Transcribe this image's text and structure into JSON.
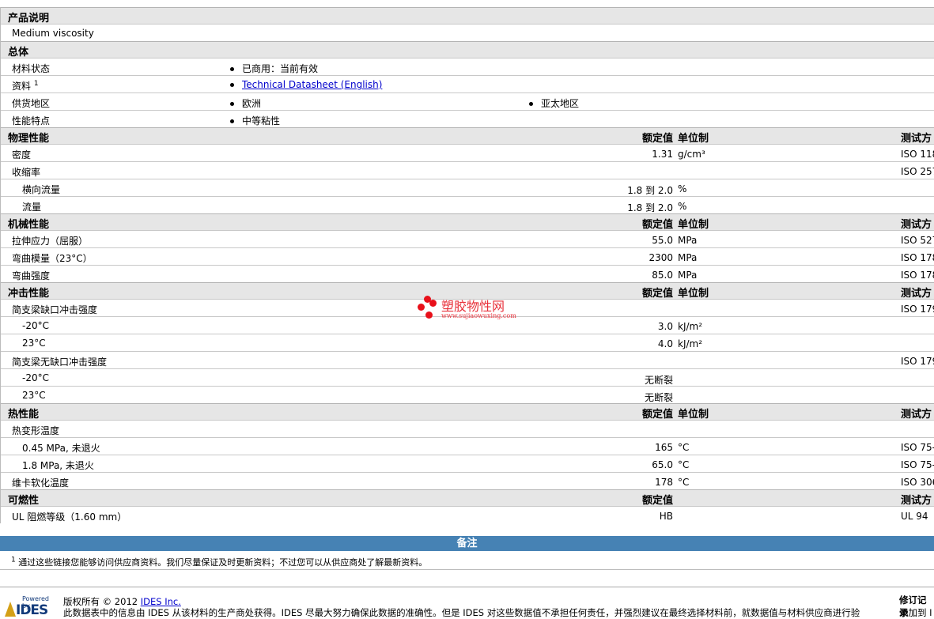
{
  "sections": [
    {
      "title": "产品说明",
      "rows": [
        {
          "label": "Medium viscosity"
        }
      ]
    },
    {
      "title": "总体",
      "rows": [
        {
          "label": "材料状态",
          "b1": "已商用：当前有效"
        },
        {
          "label": "资料",
          "sup": "1",
          "b1": "Technical Datasheet (English)",
          "link": true
        },
        {
          "label": "供货地区",
          "b1": "欧洲",
          "b2": "亚太地区"
        },
        {
          "label": "性能特点",
          "b1": "中等粘性"
        }
      ]
    },
    {
      "title": "物理性能",
      "value": "额定值",
      "unit": "单位制",
      "test": "测试方",
      "rows": [
        {
          "label": "密度",
          "value": "1.31",
          "unit": "g/cm³",
          "test": "ISO 118"
        },
        {
          "label": "收缩率",
          "test": "ISO 257"
        },
        {
          "label": "横向流量",
          "sub": true,
          "value": "1.8 到  2.0",
          "unit": "%"
        },
        {
          "label": "流量",
          "sub": true,
          "value": "1.8 到  2.0",
          "unit": "%"
        }
      ]
    },
    {
      "title": "机械性能",
      "value": "额定值",
      "unit": "单位制",
      "test": "测试方",
      "rows": [
        {
          "label": "拉伸应力（屈服）",
          "value": "55.0",
          "unit": "MPa",
          "test": "ISO 527"
        },
        {
          "label": "弯曲模量（23°C）",
          "value": "2300",
          "unit": "MPa",
          "test": "ISO 178"
        },
        {
          "label": "弯曲强度",
          "value": "85.0",
          "unit": "MPa",
          "test": "ISO 178"
        }
      ]
    },
    {
      "title": "冲击性能",
      "value": "额定值",
      "unit": "单位制",
      "test": "测试方",
      "rows": [
        {
          "label": "简支梁缺口冲击强度",
          "test": "ISO 179"
        },
        {
          "label": "-20°C",
          "sub": true,
          "value": "3.0",
          "unit": "kJ/m²"
        },
        {
          "label": "23°C",
          "sub": true,
          "value": "4.0",
          "unit": "kJ/m²"
        },
        {
          "label": "简支梁无缺口冲击强度",
          "test": "ISO 179"
        },
        {
          "label": "-20°C",
          "sub": true,
          "value": "无断裂"
        },
        {
          "label": "23°C",
          "sub": true,
          "value": "无断裂"
        }
      ]
    },
    {
      "title": "热性能",
      "value": "额定值",
      "unit": "单位制",
      "test": "测试方",
      "rows": [
        {
          "label": "热变形温度"
        },
        {
          "label": "0.45 MPa, 未退火",
          "sub": true,
          "value": "165",
          "unit": "°C",
          "test": "ISO 75-2"
        },
        {
          "label": "1.8 MPa, 未退火",
          "sub": true,
          "value": "65.0",
          "unit": "°C",
          "test": "ISO 75-2"
        },
        {
          "label": "维卡软化温度",
          "value": "178",
          "unit": "°C",
          "test": "ISO 306"
        }
      ]
    },
    {
      "title": "可燃性",
      "value": "额定值",
      "test": "测试方",
      "rows": [
        {
          "label": "UL 阻燃等级（1.60 mm）",
          "value": "HB",
          "test": "UL 94"
        }
      ]
    }
  ],
  "notes": {
    "title": "备注",
    "footnote_mark": "1",
    "footnote": "通过这些链接您能够访问供应商资料。我们尽量保证及时更新资料；不过您可以从供应商处了解最新资料。"
  },
  "footer": {
    "logo_powered": "Powered by",
    "logo_name": "IDES",
    "copyright": "版权所有 © 2012 ",
    "company_link": "IDES Inc.",
    "disclaimer": "此数据表中的信息由 IDES 从该材料的生产商处获得。IDES 尽最大努力确保此数据的准确性。但是 IDES 对这些数据值不承担任何责任，并强烈建议在最终选择材料前，就数据值与材料供应商进行验",
    "revision_title": "修订记录",
    "added": "添加到 I"
  },
  "watermark": {
    "name": "塑胶物性网",
    "url": "www.sujiaowuxing.com"
  }
}
